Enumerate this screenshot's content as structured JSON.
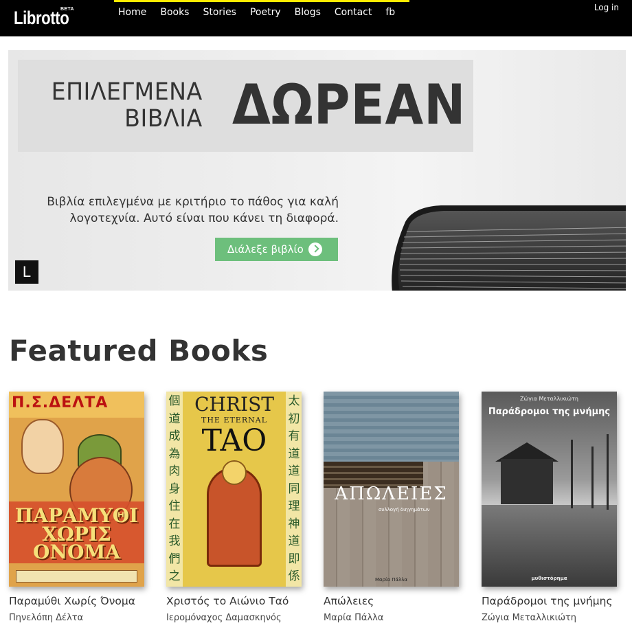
{
  "brand": {
    "name": "Librotto",
    "badge": "BETA"
  },
  "nav": {
    "items": [
      {
        "label": "Home"
      },
      {
        "label": "Books"
      },
      {
        "label": "Stories"
      },
      {
        "label": "Poetry"
      },
      {
        "label": "Blogs"
      },
      {
        "label": "Contact"
      },
      {
        "label": "fb"
      }
    ],
    "login_label": "Log in"
  },
  "colors": {
    "navbar": "#000000",
    "accent": "#ffeb00",
    "cta": "#6dbf7c",
    "text": "#333333"
  },
  "hero": {
    "line1": "ΕΠΙΛΕΓΜΕΝΑ",
    "line2": "ΒΙΒΛΙΑ",
    "headline": "ΔΩΡΕΑΝ",
    "description": "Βιβλία επιλεγμένα με κριτήριο το πάθος για καλή λογοτεχνία. Αυτό είναι που κάνει τη διαφορά.",
    "cta_label": "Διάλεξε βιβλίο",
    "cta_icon": "chevron-circle-right-icon",
    "badge_letter": "L"
  },
  "featured": {
    "heading": "Featured Books",
    "books": [
      {
        "title": "Παραμύθι Χωρίς Όνομα",
        "author": "Πηνελόπη Δέλτα",
        "cover": {
          "header": "Π.Σ.ΔΕΛΤΑ",
          "text": "ΠΑΡΑΜΥΘΙ ΧΩΡΙΣ ΟΝΟΜΑ"
        }
      },
      {
        "title": "Χριστός το Αιώνιο Ταό",
        "author": "Ιερομόναχος Δαμασκηνός",
        "cover": {
          "line1": "CHRIST",
          "line2": "THE ETERNAL",
          "line3": "TAO",
          "left_column": "個道成為肉身住在我們之中",
          "right_column": "太初有道道同理神道即係神"
        }
      },
      {
        "title": "Απώλειες",
        "author": "Μαρία Πάλλα",
        "cover": {
          "title": "ΑΠΩΛΕΙΕΣ",
          "subtitle": "συλλογή διηγημάτων",
          "footer": "Μαρία Πάλλα"
        }
      },
      {
        "title": "Παράδρομοι της μνήμης",
        "author": "Ζώγια Μεταλλικιώτη",
        "cover": {
          "author": "Ζώγια Μεταλλικιώτη",
          "title": "Παράδρομοι της μνήμης",
          "footer": "μυθιστόρημα"
        }
      }
    ]
  }
}
